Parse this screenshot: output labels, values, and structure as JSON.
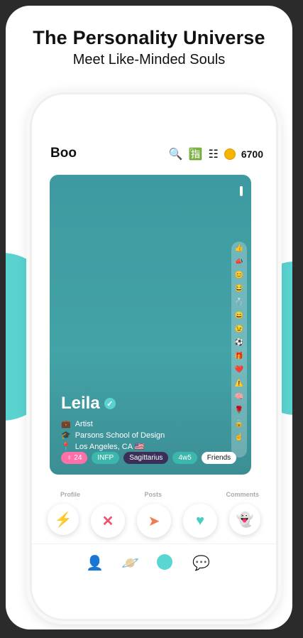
{
  "headline": {
    "title": "The Personality Universe",
    "subtitle": "Meet Like-Minded Souls"
  },
  "app": {
    "brand": "Boo",
    "coins": "6700",
    "icons": [
      "search-icon",
      "translate-icon",
      "filter-icon",
      "coin-icon"
    ]
  },
  "profile": {
    "name": "Leila",
    "occupation": "Artist",
    "school": "Parsons School of Design",
    "location": "Los Angeles, CA 🇺🇸",
    "tags": [
      "♀ 24",
      "INFP",
      "Sagittarius",
      "4w5",
      "Friends"
    ]
  },
  "tabs": [
    "Profile",
    "Posts",
    "Comments"
  ],
  "actions": [
    "bolt",
    "reject",
    "send",
    "like",
    "ghost"
  ],
  "nav": [
    "profile",
    "explore",
    "home",
    "chat"
  ],
  "colors": {
    "accent": "#5ad3d0",
    "bg": "#3e9aa0"
  }
}
